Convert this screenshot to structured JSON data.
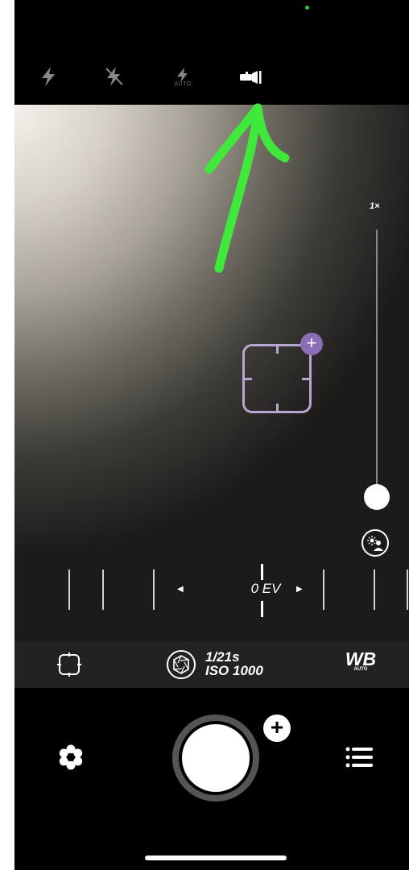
{
  "flash": {
    "options": [
      {
        "name": "flash-on",
        "icon": "lightning-bolt-icon"
      },
      {
        "name": "flash-off",
        "icon": "lightning-bolt-slash-icon"
      },
      {
        "name": "flash-auto",
        "icon": "lightning-bolt-auto-icon",
        "label": "AUTO"
      },
      {
        "name": "torch",
        "icon": "flashlight-icon",
        "selected": true
      }
    ]
  },
  "zoom": {
    "label": "1×",
    "level": 0.0
  },
  "exposure": {
    "label": "0 EV"
  },
  "info": {
    "shutter_speed": "1/21s",
    "iso": "ISO 1000",
    "wb_label": "WB",
    "wb_sub": "AUTO"
  },
  "colors": {
    "accent_green": "#3fe83a",
    "focus_purple": "#b6a6d1",
    "focus_plus": "#8c6eb8"
  }
}
